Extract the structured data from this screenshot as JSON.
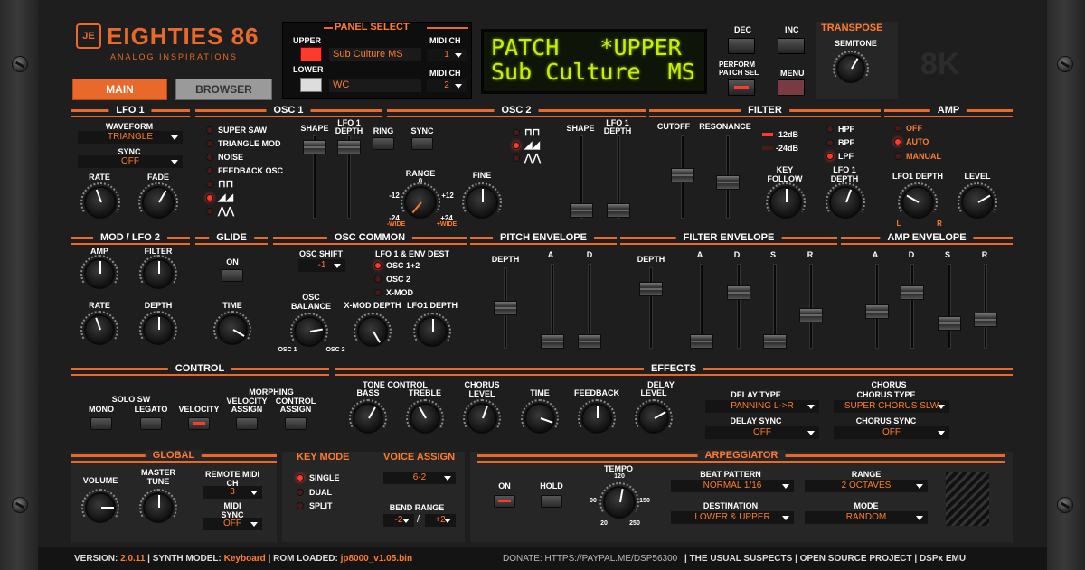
{
  "top": {
    "brand": "EIGHTIES 86",
    "brand_sub": "ANALOG INSPIRATIONS",
    "brand_logo": "JE",
    "tab_main": "MAIN",
    "tab_browser": "BROWSER",
    "panel_select": "PANEL SELECT",
    "upper": "UPPER",
    "lower": "LOWER",
    "upper_patch": "Sub Culture MS",
    "lower_patch": "WC",
    "midi_ch": "MIDI CH",
    "upper_midi": "1",
    "lower_midi": "2",
    "lcd_line1": "PATCH   *UPPER",
    "lcd_line2": "Sub Culture  MS",
    "dec": "DEC",
    "inc": "INC",
    "perform": "PERFORM",
    "patch_sel": "PATCH SEL",
    "menu": "MENU",
    "transpose": "TRANSPOSE",
    "semitone": "SEMITONE",
    "logo_8k": "8K"
  },
  "lfo1": {
    "title": "LFO 1",
    "waveform_label": "WAVEFORM",
    "waveform": "TRIANGLE",
    "sync_label": "SYNC",
    "sync": "OFF",
    "rate": "RATE",
    "fade": "FADE"
  },
  "osc1": {
    "title": "OSC 1",
    "opts": [
      "SUPER SAW",
      "TRIANGLE MOD",
      "NOISE",
      "FEEDBACK OSC"
    ],
    "shape": "SHAPE",
    "lfo1_depth": "LFO 1 DEPTH"
  },
  "osc2": {
    "title": "OSC 2",
    "ring": "RING",
    "sync": "SYNC",
    "range": "RANGE",
    "r0": "0",
    "rm12": "-12",
    "rp12": "+12",
    "rm24": "-24",
    "wide_neg": "-WIDE",
    "rp24": "+24",
    "wide_pos": "+WIDE",
    "fine": "FINE",
    "shape": "SHAPE",
    "lfo1_depth": "LFO 1 DEPTH"
  },
  "filter": {
    "title": "FILTER",
    "cutoff": "CUTOFF",
    "resonance": "RESONANCE",
    "db12": "-12dB",
    "db24": "-24dB",
    "hpf": "HPF",
    "bpf": "BPF",
    "lpf": "LPF",
    "key_follow": "KEY FOLLOW",
    "lfo1_depth": "LFO 1 DEPTH"
  },
  "amp": {
    "title": "AMP",
    "off": "OFF",
    "auto": "AUTO",
    "manual": "MANUAL",
    "lfo1_depth": "LFO1 DEPTH",
    "level": "LEVEL",
    "l": "L",
    "r": "R"
  },
  "mod": {
    "title": "MOD / LFO 2",
    "amp": "AMP",
    "filter": "FILTER",
    "rate": "RATE",
    "depth": "DEPTH"
  },
  "glide": {
    "title": "GLIDE",
    "on": "ON",
    "time": "TIME"
  },
  "osccommon": {
    "title": "OSC COMMON",
    "osc_shift": "OSC SHIFT",
    "osc_shift_val": "-1",
    "dest": "LFO 1 & ENV DEST",
    "opts": [
      "OSC 1+2",
      "OSC 2",
      "X-MOD"
    ],
    "balance": "OSC BALANCE",
    "xmod": "X-MOD DEPTH",
    "lfo1_depth": "LFO1 DEPTH",
    "osc1": "OSC 1",
    "osc2": "OSC 2"
  },
  "pitchenv": {
    "title": "PITCH ENVELOPE",
    "depth": "DEPTH",
    "a": "A",
    "d": "D"
  },
  "filterenv": {
    "title": "FILTER ENVELOPE",
    "depth": "DEPTH",
    "a": "A",
    "d": "D",
    "s": "S",
    "r": "R"
  },
  "ampenv": {
    "title": "AMP ENVELOPE",
    "a": "A",
    "d": "D",
    "s": "S",
    "r": "R"
  },
  "control": {
    "title": "CONTROL",
    "solo": "SOLO SW",
    "morphing": "MORPHING",
    "mono": "MONO",
    "legato": "LEGATO",
    "velocity": "VELOCITY",
    "vel_assign": "VELOCITY ASSIGN",
    "ctrl_assign": "CONTROL ASSIGN"
  },
  "effects": {
    "title": "EFFECTS",
    "tone": "TONE CONTROL",
    "bass": "BASS",
    "treble": "TREBLE",
    "chorus_level": "CHORUS LEVEL",
    "delay": "DELAY",
    "time": "TIME",
    "feedback": "FEEDBACK",
    "level": "LEVEL",
    "delay_type": "DELAY TYPE",
    "delay_type_val": "PANNING L->R",
    "delay_sync": "DELAY SYNC",
    "delay_sync_val": "OFF",
    "chorus": "CHORUS",
    "chorus_type": "CHORUS TYPE",
    "chorus_type_val": "SUPER CHORUS SLW",
    "chorus_sync": "CHORUS SYNC",
    "chorus_sync_val": "OFF"
  },
  "global": {
    "title": "GLOBAL",
    "volume": "VOLUME",
    "master_tune": "MASTER TUNE",
    "remote_midi": "REMOTE MIDI CH",
    "remote_midi_val": "3",
    "midi_sync": "MIDI SYNC",
    "midi_sync_val": "OFF"
  },
  "keymode": {
    "title": "KEY MODE",
    "single": "SINGLE",
    "dual": "DUAL",
    "split": "SPLIT"
  },
  "voice": {
    "title": "VOICE ASSIGN",
    "val": "6-2",
    "bend": "BEND RANGE",
    "bend_neg": "-2",
    "bend_pos": "+2"
  },
  "arp": {
    "title": "ARPEGGIATOR",
    "on": "ON",
    "hold": "HOLD",
    "tempo": "TEMPO",
    "t120": "120",
    "t90": "90",
    "t150": "150",
    "t20": "20",
    "t250": "250",
    "beat": "BEAT PATTERN",
    "beat_val": "NORMAL 1/16",
    "range": "RANGE",
    "range_val": "2 OCTAVES",
    "dest": "DESTINATION",
    "dest_val": "LOWER & UPPER",
    "mode": "MODE",
    "mode_val": "RANDOM"
  },
  "footer": {
    "version_label": "VERSION:",
    "version": "2.0.11",
    "model_label": "SYNTH MODEL:",
    "model": "Keyboard",
    "rom_label": "ROM LOADED:",
    "rom": "jp8000_v1.05.bin",
    "donate": "DONATE: HTTPS://PAYPAL.ME/DSP56300",
    "s1": "THE USUAL SUSPECTS",
    "s2": "OPEN SOURCE PROJECT",
    "s3": "DSPx EMU"
  },
  "colors": {
    "accent": "#e8692a",
    "lcd": "#c8f000",
    "led": "#ff3a2a"
  }
}
